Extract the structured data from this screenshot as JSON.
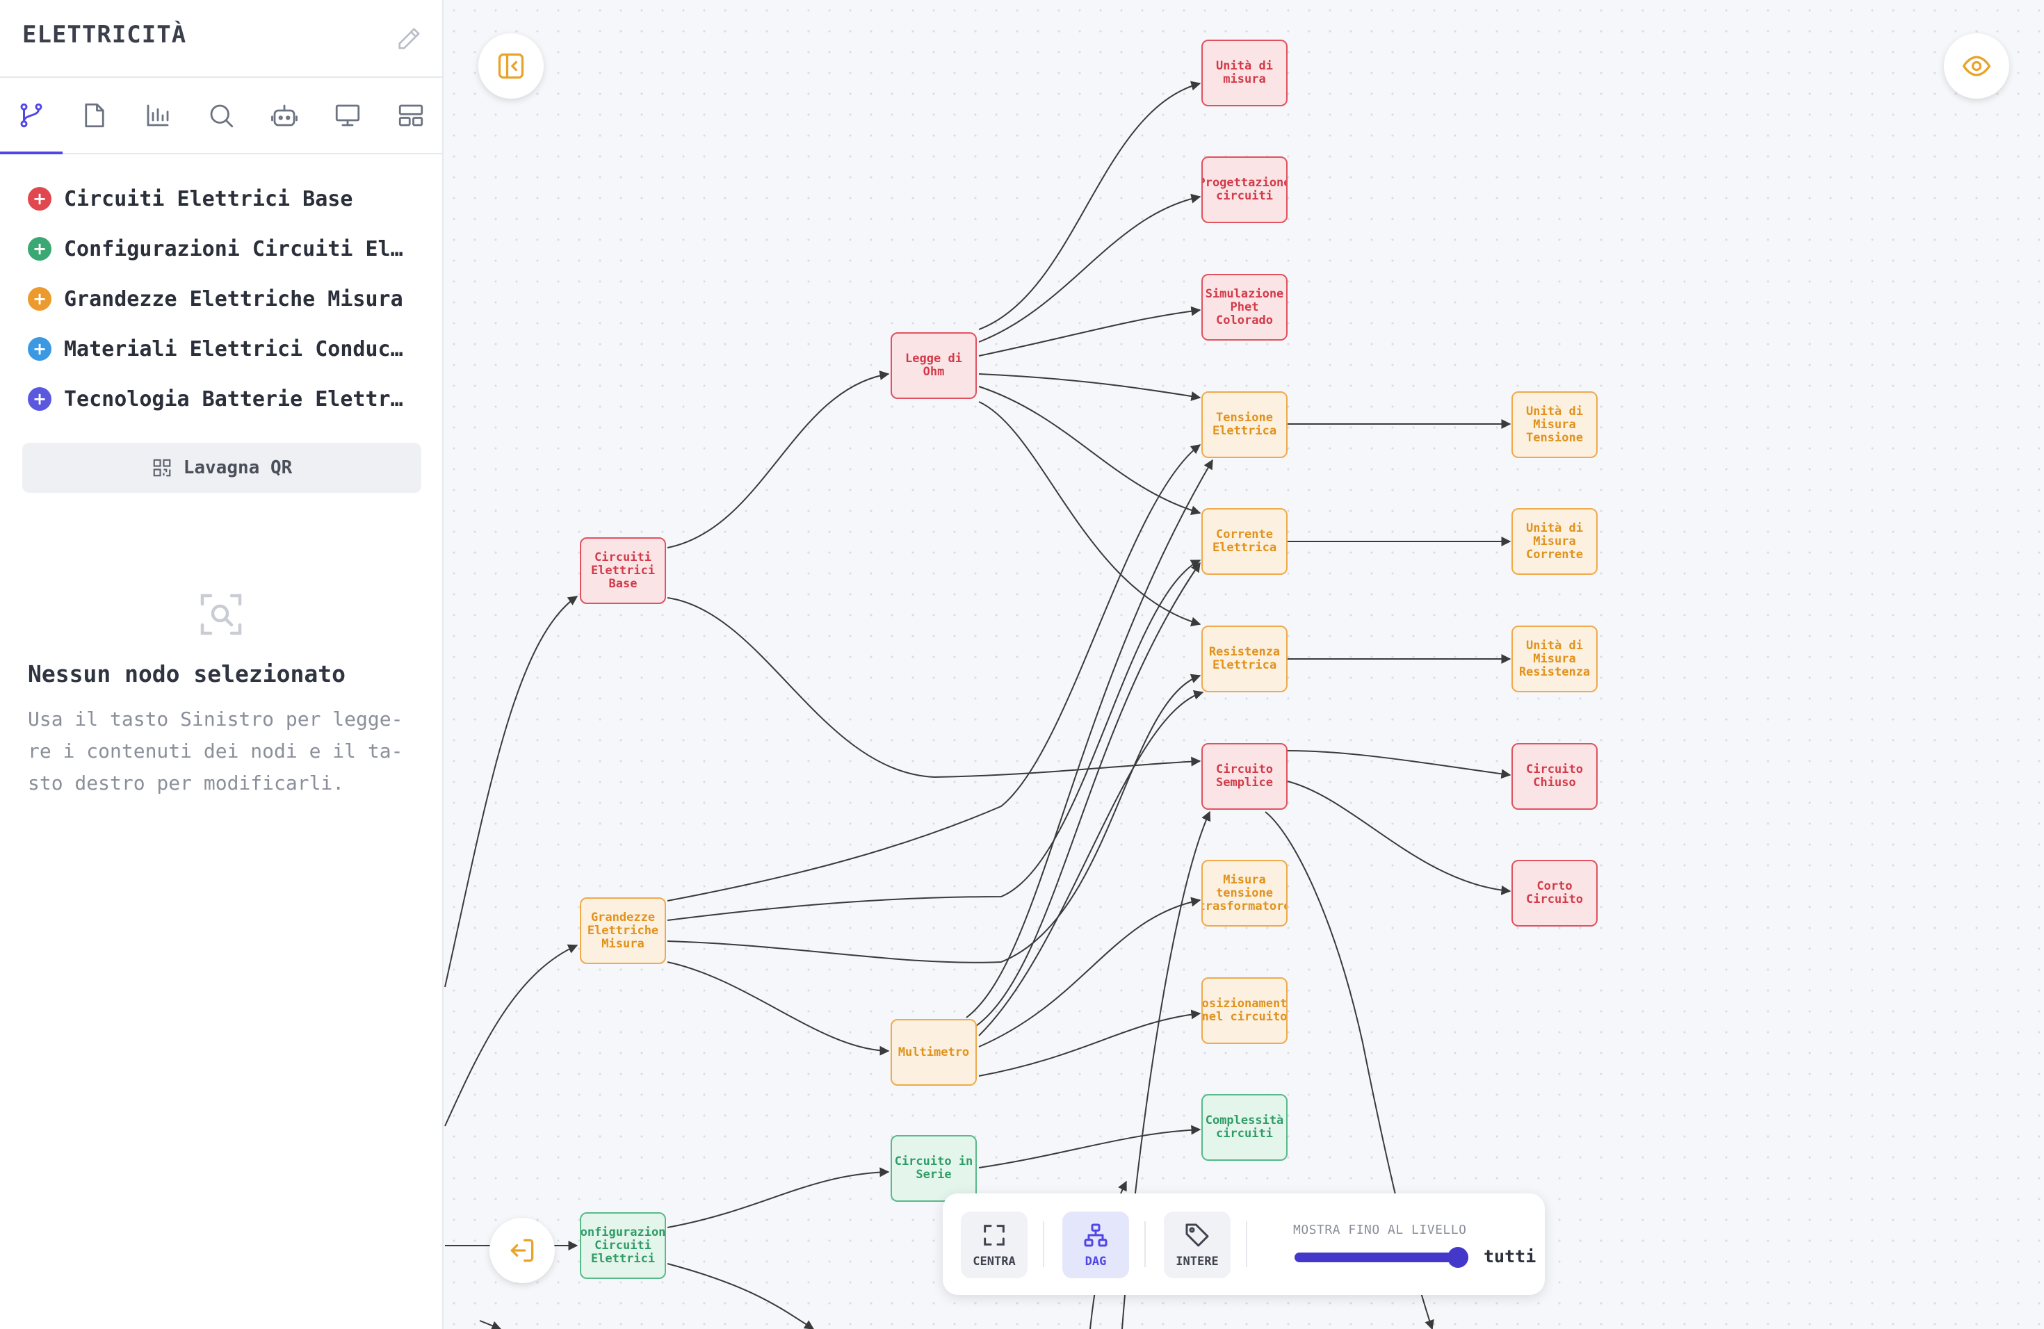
{
  "sidebar": {
    "title": "ELETTRICITÀ",
    "tabs": [
      "branch-icon",
      "document-icon",
      "chart-icon",
      "search-icon",
      "robot-icon",
      "presentation-icon",
      "layout-icon"
    ],
    "maps": [
      {
        "label": "Circuiti Elettrici Base",
        "color": "#e0474f"
      },
      {
        "label": "Configurazioni Circuiti Elettrici",
        "color": "#3aa872"
      },
      {
        "label": "Grandezze Elettriche Misura",
        "color": "#ec9a2c"
      },
      {
        "label": "Materiali Elettrici Conducibilità",
        "color": "#3b98e3"
      },
      {
        "label": "Tecnologia Batterie Elettriche",
        "color": "#5b58e0"
      }
    ],
    "qr_label": "Lavagna QR",
    "empty_title": "Nessun nodo selezionato",
    "empty_text": "Usa il tasto Sinistro per legge-re i contenuti dei nodi e il ta-sto destro per modificarli."
  },
  "nodes": {
    "unita_misura": "Unità di misura",
    "progettazione": "Progettazione circuiti",
    "simulazione": "Simulazione Phet Colorado",
    "legge_ohm": "Legge di Ohm",
    "tensione": "Tensione Elettrica",
    "um_tensione": "Unità di Misura Tensione",
    "corrente": "Corrente Elettrica",
    "um_corrente": "Unità di Misura Corrente",
    "circuiti_base": "Circuiti Elettrici Base",
    "resistenza": "Resistenza Elettrica",
    "um_resistenza": "Unità di Misura Resistenza",
    "circuito_semplice": "Circuito Semplice",
    "circuito_chiuso": "Circuito Chiuso",
    "grandezze": "Grandezze Elettriche Misura",
    "misura_tensione": "Misura tensione trasformatore",
    "corto_circuito": "Corto Circuito",
    "multimetro": "Multimetro",
    "posizionamento": "Posizionamento nel circuito",
    "complessita": "Complessità circuiti",
    "circuito_serie": "Circuito in Serie",
    "configurazioni": "Configurazioni Circuiti Elettrici"
  },
  "toolbar": {
    "center_label": "CENTRA",
    "dag_label": "DAG",
    "intere_label": "INTERE",
    "level_label": "MOSTRA FINO AL LIVELLO",
    "level_value": "tutti",
    "slider_fraction": 1.0
  },
  "colors": {
    "accent": "#4f46e5",
    "red": "#e0525e",
    "orange": "#efaa4a",
    "green": "#59b98a",
    "edge": "#3a3a3a"
  }
}
